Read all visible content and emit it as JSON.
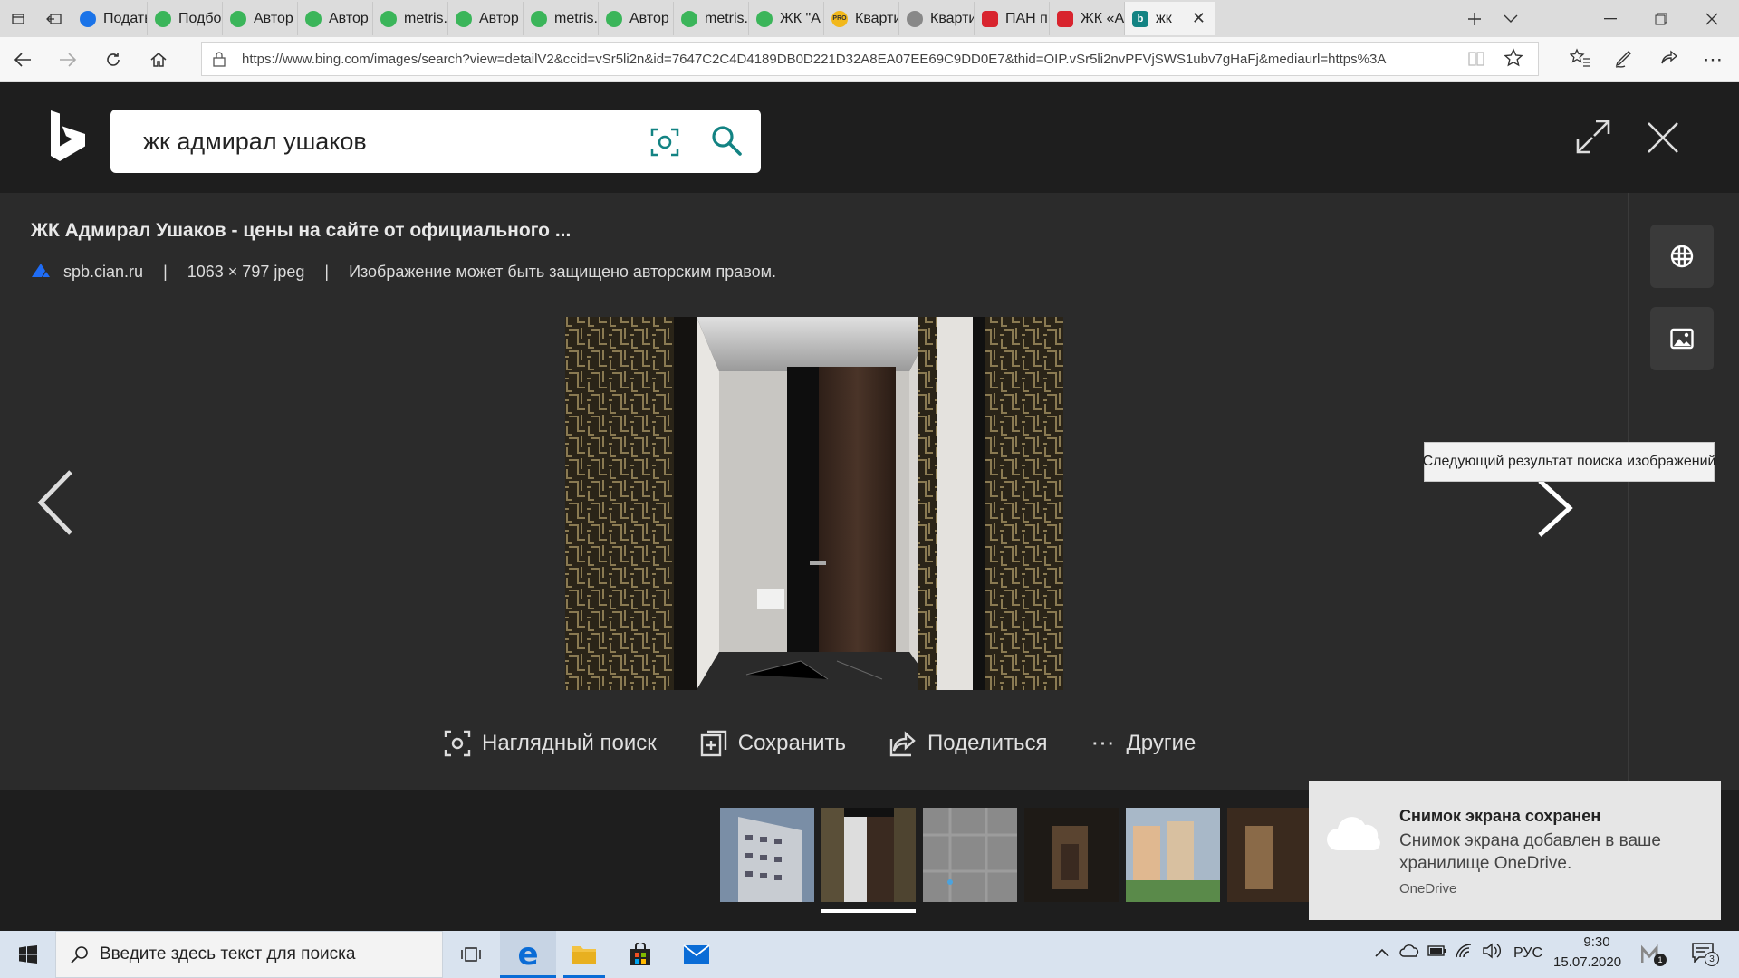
{
  "browser": {
    "tabs": [
      {
        "label": "Подать",
        "favicon": "blue"
      },
      {
        "label": "Подбо",
        "favicon": "m"
      },
      {
        "label": "Автор",
        "favicon": "m"
      },
      {
        "label": "Автор",
        "favicon": "m"
      },
      {
        "label": "metris.",
        "favicon": "m"
      },
      {
        "label": "Автор",
        "favicon": "m"
      },
      {
        "label": "metris.",
        "favicon": "m"
      },
      {
        "label": "Автор",
        "favicon": "m"
      },
      {
        "label": "metris.",
        "favicon": "m"
      },
      {
        "label": "ЖК \"А",
        "favicon": "m"
      },
      {
        "label": "Кварти",
        "favicon": "pro"
      },
      {
        "label": "Кварти",
        "favicon": "gr"
      },
      {
        "label": "ПАН п",
        "favicon": "r"
      },
      {
        "label": "ЖК «А",
        "favicon": "r"
      },
      {
        "label": "жк",
        "favicon": "b"
      }
    ],
    "favicon_text": {
      "b": "b",
      "pro": "PRO",
      "m": "",
      "r": "",
      "gr": "",
      "blue": ""
    },
    "url": "https://www.bing.com/images/search?view=detailV2&ccid=vSr5li2n&id=7647C2C4D4189DB0D221D32A8EA07EE69C9DD0E7&thid=OIP.vSr5li2nvPFVjSWS1ubv7gHaFj&mediaurl=https%3A"
  },
  "search": {
    "query": "жк адмирал ушаков"
  },
  "detail": {
    "title": "ЖК Адмирал Ушаков - цены на сайте от официального ...",
    "source": "spb.cian.ru",
    "sep1": "|",
    "size": "1063 × 797 jpeg",
    "sep2": "|",
    "copyright": "Изображение может быть защищено авторским правом."
  },
  "actions": {
    "visual_search": "Наглядный поиск",
    "save": "Сохранить",
    "share": "Поделиться",
    "more": "Другие"
  },
  "tooltip": "Следующий результат поиска изображений",
  "toast": {
    "title": "Снимок экрана сохранен",
    "body": "Снимок экрана добавлен в ваше хранилище OneDrive.",
    "app": "OneDrive"
  },
  "taskbar": {
    "search_placeholder": "Введите здесь текст для поиска",
    "lang": "РУС",
    "time": "9:30",
    "date": "15.07.2020",
    "notif_count": "3",
    "badge": "1"
  },
  "colors": {
    "bing_teal": "#138383",
    "onedrive": "#ffffff",
    "edge_blue": "#0a6cd6"
  }
}
